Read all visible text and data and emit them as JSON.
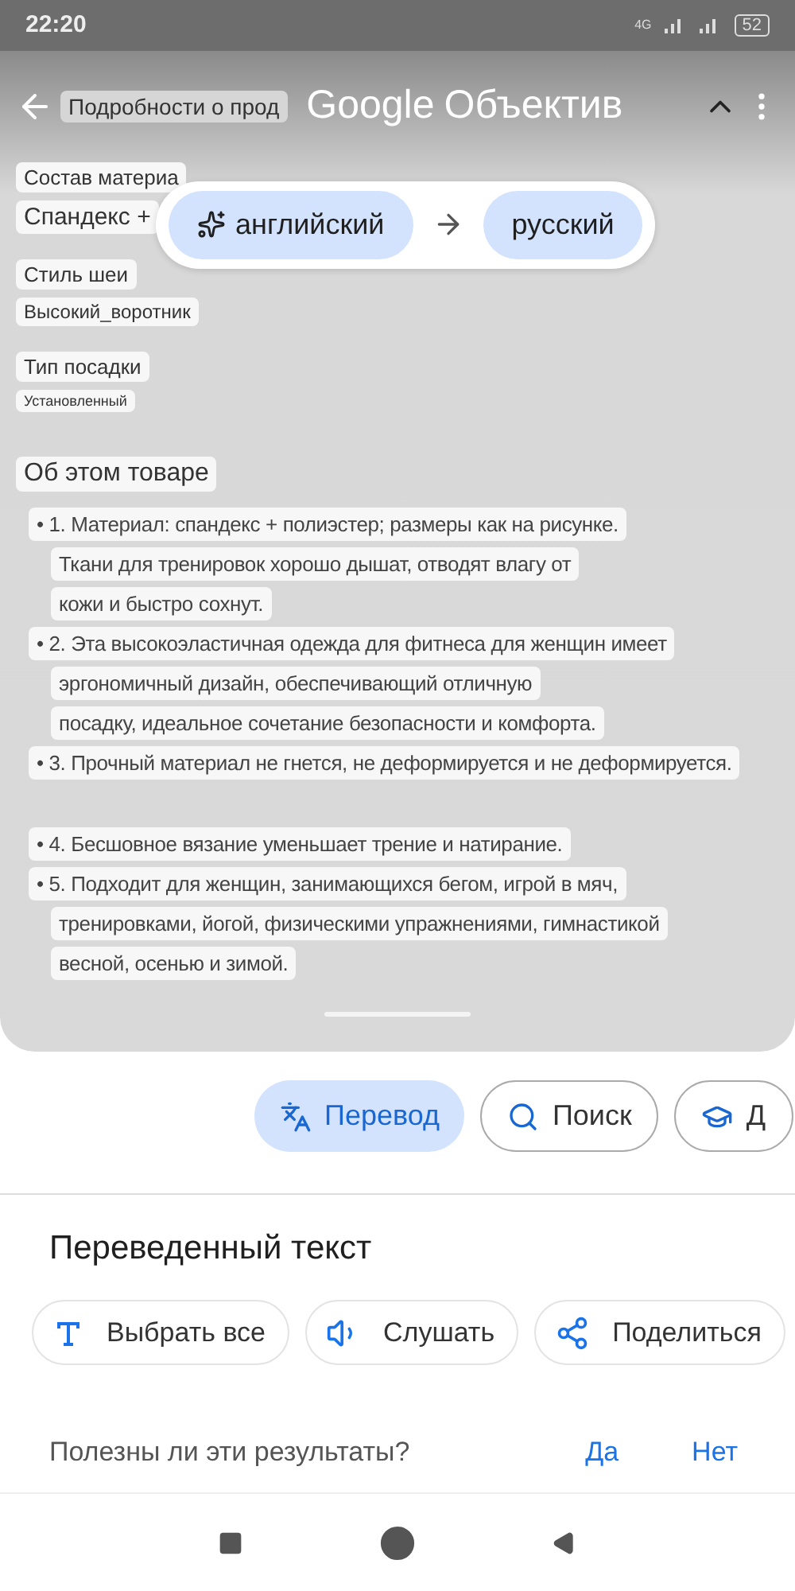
{
  "status_bar": {
    "time": "22:20",
    "network": "4G",
    "battery": "52"
  },
  "header": {
    "title_brand": "Google",
    "title_product": "Объектив"
  },
  "language_pill": {
    "source": "английский",
    "target": "русский"
  },
  "image_text": {
    "details_label": "Подробности о прод",
    "attributes": [
      {
        "label": "Состав материа",
        "value": "Спандекс +"
      },
      {
        "label": "Стиль шеи",
        "value": "Высокий_воротник"
      },
      {
        "label": "Тип посадки",
        "value": "Установленный"
      }
    ],
    "about_title": "Об этом товаре",
    "bullets": [
      {
        "lines": [
          "• 1. Материал: спандекс + полиэстер; размеры как на рисунке.",
          "Ткани для тренировок хорошо дышат, отводят влагу от",
          "кожи и быстро сохнут."
        ]
      },
      {
        "lines": [
          "• 2. Эта высокоэластичная одежда для фитнеса для женщин имеет",
          "эргономичный дизайн, обеспечивающий отличную",
          "посадку, идеальное сочетание безопасности и комфорта."
        ]
      },
      {
        "lines": [
          "• 3. Прочный материал не гнется, не деформируется и не деформируется."
        ]
      },
      {
        "lines": [
          "• 4. Бесшовное вязание уменьшает трение и натирание."
        ]
      },
      {
        "lines": [
          "• 5. Подходит для женщин, занимающихся бегом, игрой в мяч,",
          "тренировками, йогой, физическими упражнениями, гимнастикой",
          "весной, осенью и зимой."
        ]
      }
    ]
  },
  "mode_chips": [
    {
      "label": "Перевод",
      "kind": "translate",
      "selected": true
    },
    {
      "label": "Поиск",
      "kind": "search",
      "selected": false
    },
    {
      "label": "Д",
      "kind": "homework",
      "selected": false
    }
  ],
  "sheet": {
    "title": "Переведенный текст",
    "actions": [
      {
        "label": "Выбрать все",
        "kind": "select"
      },
      {
        "label": "Слушать",
        "kind": "listen"
      },
      {
        "label": "Поделиться",
        "kind": "share"
      }
    ],
    "feedback": {
      "question": "Полезны ли эти результаты?",
      "yes": "Да",
      "no": "Нет"
    }
  }
}
